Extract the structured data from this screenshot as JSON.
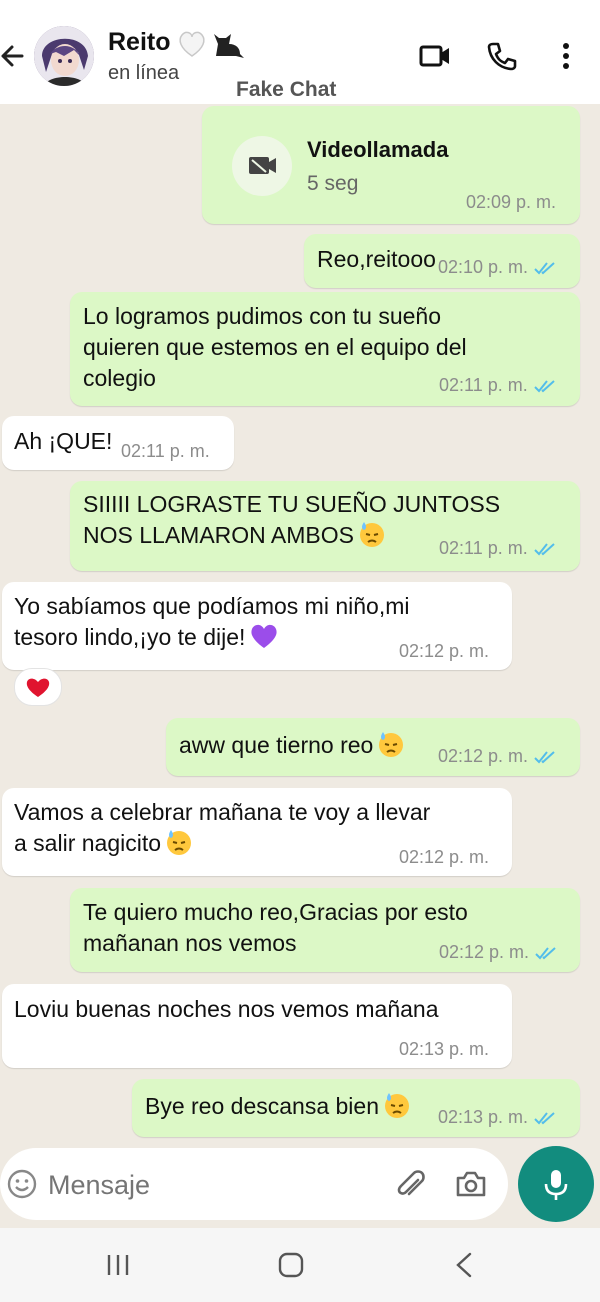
{
  "header": {
    "contact_name": "Reito",
    "name_emojis": "🤍🐈‍⬛",
    "status": "en línea",
    "watermark": "Fake Chat"
  },
  "call_card": {
    "title": "Videollamada",
    "duration": "5 seg",
    "time": "02:09 p. m."
  },
  "messages": [
    {
      "dir": "out",
      "text": "Reo,reitooo",
      "time": "02:10 p. m."
    },
    {
      "dir": "out",
      "line1": "Lo logramos pudimos con tu sueño",
      "line2": "quieren que estemos en el equipo del",
      "line3": "colegio",
      "time": "02:11 p. m."
    },
    {
      "dir": "in",
      "text": "Ah ¡QUE!",
      "time": "02:11 p. m."
    },
    {
      "dir": "out",
      "line1": "SIIIII LOGRASTE TU SUEÑO JUNTOSS",
      "line2": "NOS LLAMARON AMBOS",
      "emoji": "😓",
      "time": "02:11 p. m."
    },
    {
      "dir": "in",
      "line1": "Yo sabíamos que podíamos mi niño,mi",
      "line2": "tesoro lindo,¡yo te dije!",
      "emoji": "💜",
      "time": "02:12 p. m.",
      "reaction": "❤️"
    },
    {
      "dir": "out",
      "text": "aww que tierno reo",
      "emoji": "😓",
      "time": "02:12 p. m."
    },
    {
      "dir": "in",
      "line1": "Vamos a celebrar mañana te voy a llevar",
      "line2": "a salir nagicito",
      "emoji": "😓",
      "time": "02:12 p. m."
    },
    {
      "dir": "out",
      "line1": "Te quiero mucho reo,Gracias por esto",
      "line2": "mañanan nos vemos",
      "time": "02:12 p. m."
    },
    {
      "dir": "in",
      "text": "Loviu buenas noches nos vemos mañana",
      "time": "02:13 p. m."
    },
    {
      "dir": "out",
      "text": "Bye reo descansa bien",
      "emoji": "😓",
      "time": "02:13 p. m."
    }
  ],
  "composer": {
    "placeholder": "Mensaje"
  },
  "colors": {
    "outgoing_bubble": "#dcf8c6",
    "incoming_bubble": "#ffffff",
    "accent": "#128c7e",
    "read_ticks": "#53bdeb"
  },
  "icons": [
    "back-arrow-icon",
    "video-call-icon",
    "phone-icon",
    "more-options-icon",
    "video-camera-icon",
    "read-ticks-icon",
    "emoji-icon",
    "attach-icon",
    "camera-icon",
    "mic-icon",
    "recent-apps-icon",
    "home-icon",
    "nav-back-icon"
  ]
}
